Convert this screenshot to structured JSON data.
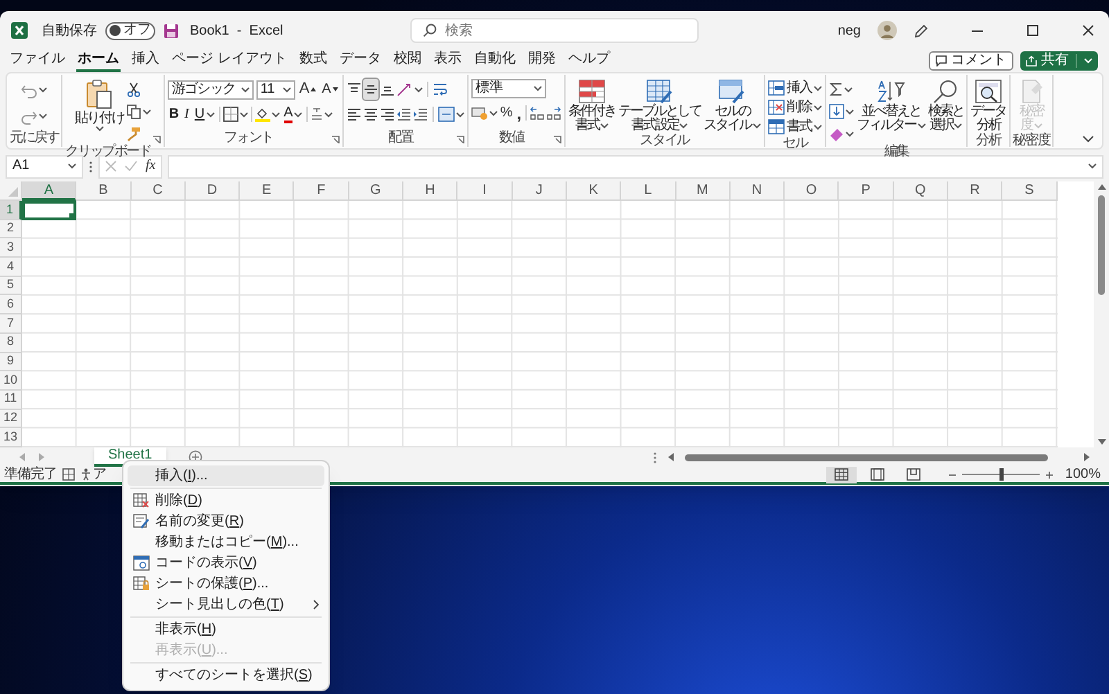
{
  "window": {
    "title": "Book1  -  Excel",
    "autosave_label": "自動保存",
    "autosave_toggle": {
      "on": false,
      "label": "オフ"
    },
    "search": {
      "placeholder": "検索"
    },
    "user_name": "neg"
  },
  "menu_tabs": [
    {
      "label": "ファイル",
      "selected": false
    },
    {
      "label": "ホーム",
      "selected": true
    },
    {
      "label": "挿入",
      "selected": false
    },
    {
      "label": "ページ レイアウト",
      "selected": false
    },
    {
      "label": "数式",
      "selected": false
    },
    {
      "label": "データ",
      "selected": false
    },
    {
      "label": "校閲",
      "selected": false
    },
    {
      "label": "表示",
      "selected": false
    },
    {
      "label": "自動化",
      "selected": false
    },
    {
      "label": "開発",
      "selected": false
    },
    {
      "label": "ヘルプ",
      "selected": false
    }
  ],
  "comment_button": "コメント",
  "share_button": "共有",
  "ribbon": {
    "groups": [
      {
        "label": "元に戻す"
      },
      {
        "label": "クリップボード",
        "paste": "貼り付け"
      },
      {
        "label": "フォント",
        "font_name": "游ゴシック",
        "font_size": "11",
        "grow_font": "A",
        "shrink_font": "A",
        "bold": "B",
        "italic": "I",
        "underline": "U",
        "font_color": "A"
      },
      {
        "label": "配置",
        "vertical_align": [
          {
            "selected": false
          },
          {
            "selected": true
          },
          {
            "selected": false
          }
        ]
      },
      {
        "label": "数値",
        "format": "標準",
        "percent": "%",
        "comma": ","
      },
      {
        "label": "スタイル",
        "buttons": [
          {
            "lines": [
              "条件付き",
              "書式"
            ]
          },
          {
            "lines": [
              "テーブルとして",
              "書式設定"
            ]
          },
          {
            "lines": [
              "セルの",
              "スタイル"
            ]
          }
        ]
      },
      {
        "label": "セル",
        "buttons": [
          "挿入",
          "削除",
          "書式"
        ]
      },
      {
        "label": "編集",
        "buttons": [
          {
            "lines": [
              "並べ替えと",
              "フィルター"
            ]
          },
          {
            "lines": [
              "検索と",
              "選択"
            ]
          }
        ]
      },
      {
        "label": "分析",
        "buttons": [
          {
            "lines": [
              "データ",
              "分析"
            ],
            "disabled": false
          }
        ]
      },
      {
        "label": "秘密度",
        "buttons": [
          {
            "lines": [
              "秘密",
              "度"
            ],
            "disabled": true
          }
        ]
      }
    ]
  },
  "formula_bar": {
    "name_box": "A1",
    "fx": "fx"
  },
  "grid": {
    "columns": [
      {
        "label": "A",
        "selected": true
      },
      {
        "label": "B",
        "selected": false
      },
      {
        "label": "C",
        "selected": false
      },
      {
        "label": "D",
        "selected": false
      },
      {
        "label": "E",
        "selected": false
      },
      {
        "label": "F",
        "selected": false
      },
      {
        "label": "G",
        "selected": false
      },
      {
        "label": "H",
        "selected": false
      },
      {
        "label": "I",
        "selected": false
      },
      {
        "label": "J",
        "selected": false
      },
      {
        "label": "K",
        "selected": false
      },
      {
        "label": "L",
        "selected": false
      },
      {
        "label": "M",
        "selected": false
      },
      {
        "label": "N",
        "selected": false
      },
      {
        "label": "O",
        "selected": false
      },
      {
        "label": "P",
        "selected": false
      },
      {
        "label": "Q",
        "selected": false
      },
      {
        "label": "R",
        "selected": false
      },
      {
        "label": "S",
        "selected": false
      }
    ],
    "rows": [
      {
        "label": "1",
        "selected": true
      },
      {
        "label": "2",
        "selected": false
      },
      {
        "label": "3",
        "selected": false
      },
      {
        "label": "4",
        "selected": false
      },
      {
        "label": "5",
        "selected": false
      },
      {
        "label": "6",
        "selected": false
      },
      {
        "label": "7",
        "selected": false
      },
      {
        "label": "8",
        "selected": false
      },
      {
        "label": "9",
        "selected": false
      },
      {
        "label": "10",
        "selected": false
      },
      {
        "label": "11",
        "selected": false
      },
      {
        "label": "12",
        "selected": false
      },
      {
        "label": "13",
        "selected": false
      }
    ]
  },
  "sheet_tabs": [
    {
      "label": "Sheet1",
      "selected": true
    }
  ],
  "status_bar": {
    "mode": "準備完了",
    "accessibility": "ア",
    "view_buttons": [
      {
        "selected": true
      },
      {
        "selected": false
      },
      {
        "selected": false
      }
    ],
    "zoom": {
      "level": 0.5,
      "label": "100%"
    }
  },
  "context_menu": {
    "items": [
      {
        "kind": "item",
        "label": "挿入(",
        "key": "I",
        "after": ")...",
        "selected": true,
        "disabled": false,
        "submenu": false
      },
      {
        "kind": "separator"
      },
      {
        "kind": "item",
        "label": "削除(",
        "key": "D",
        "after": ")",
        "selected": false,
        "disabled": false,
        "submenu": false
      },
      {
        "kind": "item",
        "label": "名前の変更(",
        "key": "R",
        "after": ")",
        "selected": false,
        "disabled": false,
        "submenu": false
      },
      {
        "kind": "item",
        "label": "移動またはコピー(",
        "key": "M",
        "after": ")...",
        "selected": false,
        "disabled": false,
        "submenu": false
      },
      {
        "kind": "item",
        "label": "コードの表示(",
        "key": "V",
        "after": ")",
        "selected": false,
        "disabled": false,
        "submenu": false
      },
      {
        "kind": "item",
        "label": "シートの保護(",
        "key": "P",
        "after": ")...",
        "selected": false,
        "disabled": false,
        "submenu": false
      },
      {
        "kind": "item",
        "label": "シート見出しの色(",
        "key": "T",
        "after": ")",
        "selected": false,
        "disabled": false,
        "submenu": true
      },
      {
        "kind": "separator"
      },
      {
        "kind": "item",
        "label": "非表示(",
        "key": "H",
        "after": ")",
        "selected": false,
        "disabled": false,
        "submenu": false
      },
      {
        "kind": "item",
        "label": "再表示(",
        "key": "U",
        "after": ")...",
        "selected": false,
        "disabled": true,
        "submenu": false
      },
      {
        "kind": "separator"
      },
      {
        "kind": "item",
        "label": "すべてのシートを選択(",
        "key": "S",
        "after": ")",
        "selected": false,
        "disabled": false,
        "submenu": false
      }
    ]
  }
}
